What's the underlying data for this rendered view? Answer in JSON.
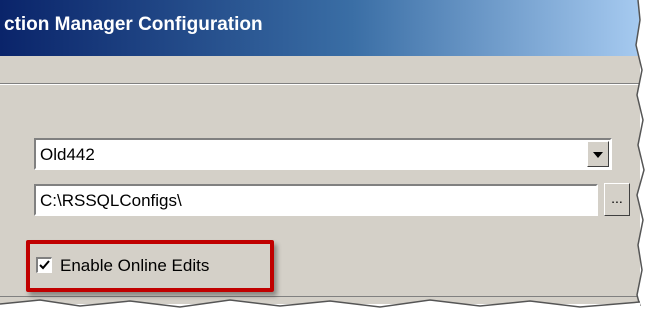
{
  "window": {
    "title": "ction Manager Configuration",
    "chrome_bg": "#d4d0c8",
    "titlebar_gradient": [
      "#0a246a",
      "#a6caf0"
    ]
  },
  "form": {
    "server_combo": {
      "value": "Old442",
      "arrow_icon": "chevron-down-icon"
    },
    "config_path": {
      "value": "C:\\RSSQLConfigs\\",
      "browse_label": "..."
    },
    "enable_online_edits": {
      "label": "Enable Online Edits",
      "checked": true
    }
  },
  "annotation": {
    "highlight_color": "#c00000"
  }
}
